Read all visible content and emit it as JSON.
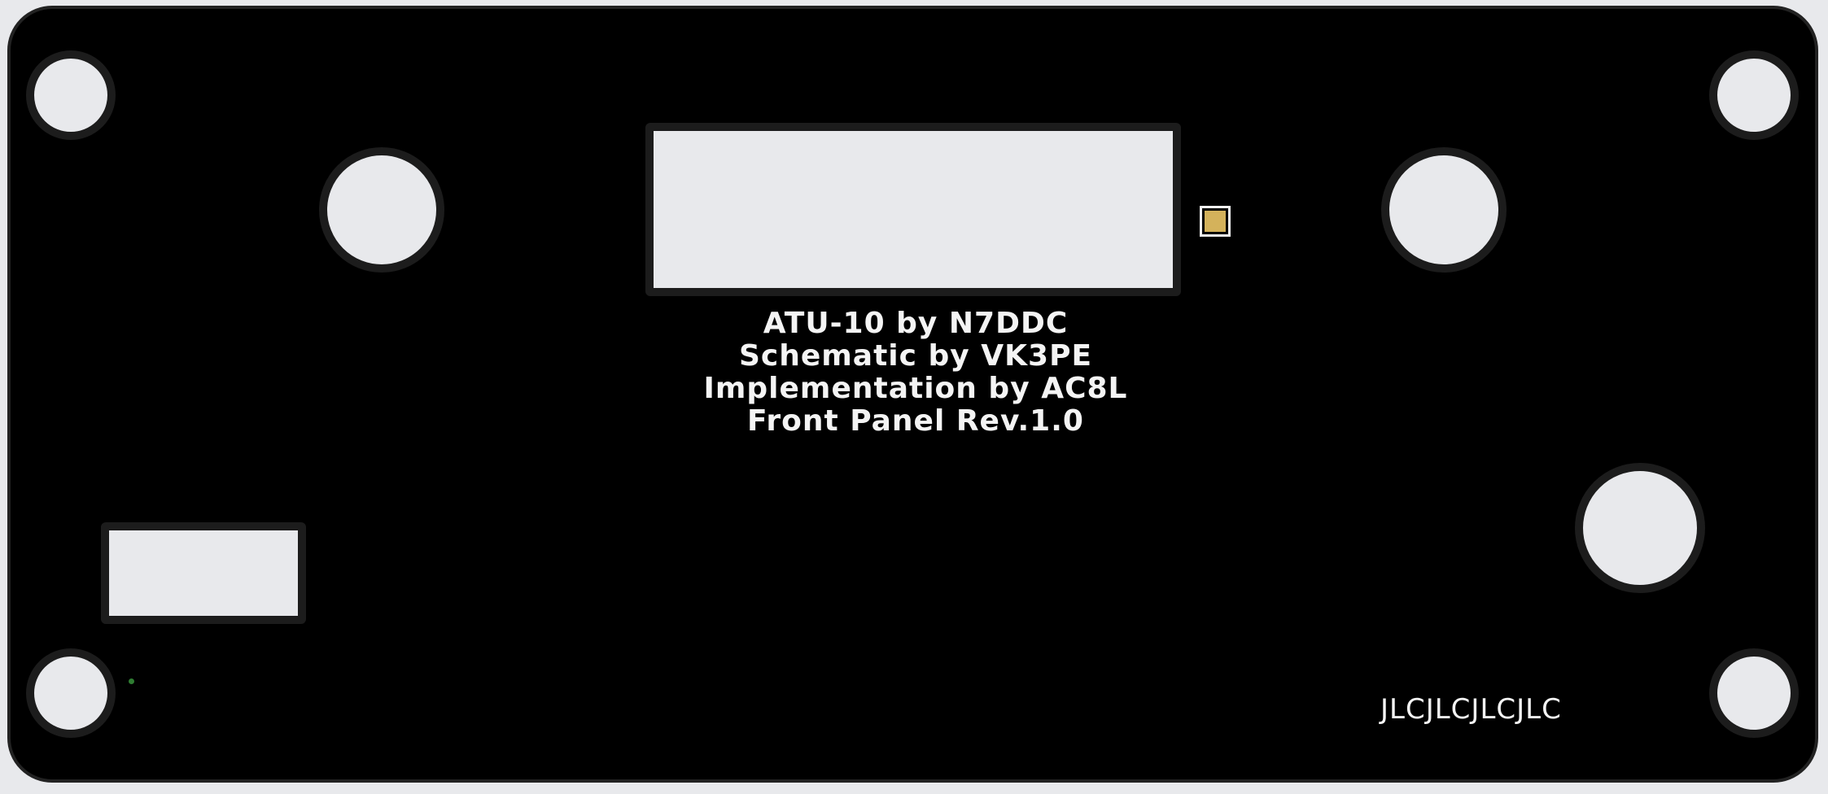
{
  "panel": {
    "silkscreen_lines": [
      "ATU-10 by N7DDC",
      "Schematic by VK3PE",
      "Implementation by AC8L",
      "Front Panel Rev.1.0"
    ],
    "jlc_marking": "JLCJLCJLCJLC"
  },
  "colors": {
    "board": "#000000",
    "board_outline": "#222222",
    "cutout_fill": "#e8e9ec",
    "silkscreen": "#f4f4f4",
    "pad": "#d4b25b",
    "via_dot": "#2f7d32"
  }
}
